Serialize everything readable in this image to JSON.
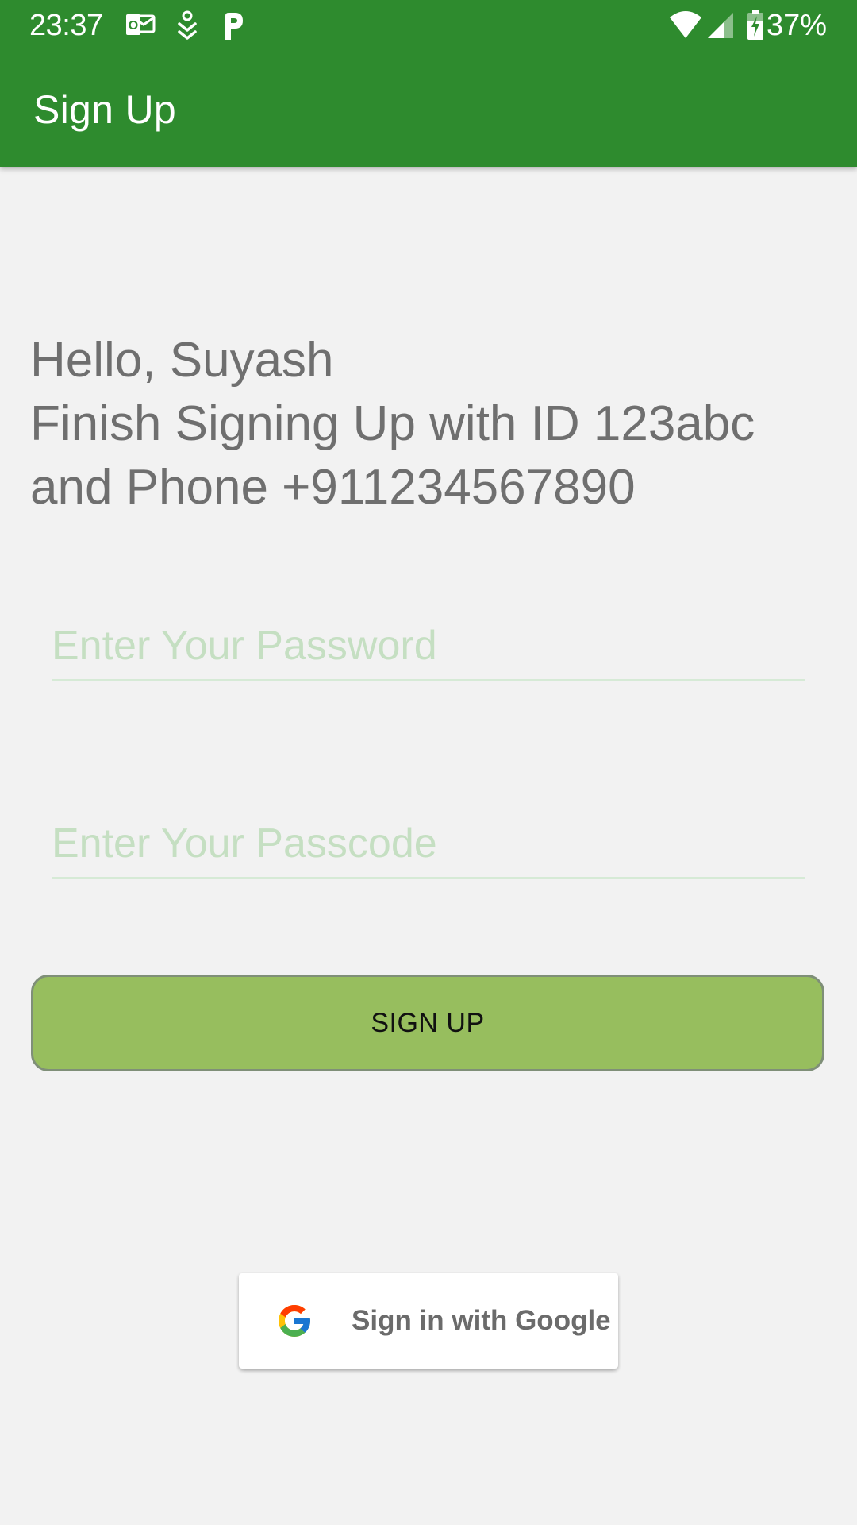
{
  "status_bar": {
    "time": "23:37",
    "notification_icons": [
      "outlook-icon",
      "download-icon",
      "paytm-icon"
    ],
    "system_icons": [
      "wifi-icon",
      "signal-icon",
      "battery-charging-icon"
    ],
    "battery_percent": "37%"
  },
  "app_bar": {
    "title": "Sign Up",
    "background_color": "#2e8b2e"
  },
  "greeting": {
    "line1": "Hello, Suyash",
    "line2": "Finish Signing Up with ID 123abc",
    "line3": "and Phone +911234567890"
  },
  "form": {
    "password_placeholder": "Enter Your Password",
    "password_value": "",
    "passcode_placeholder": "Enter Your Passcode",
    "passcode_value": "",
    "signup_label": "SIGN UP",
    "signup_color": "#97be5e"
  },
  "google": {
    "label": "Sign in with Google",
    "icon": "google-logo-icon"
  }
}
